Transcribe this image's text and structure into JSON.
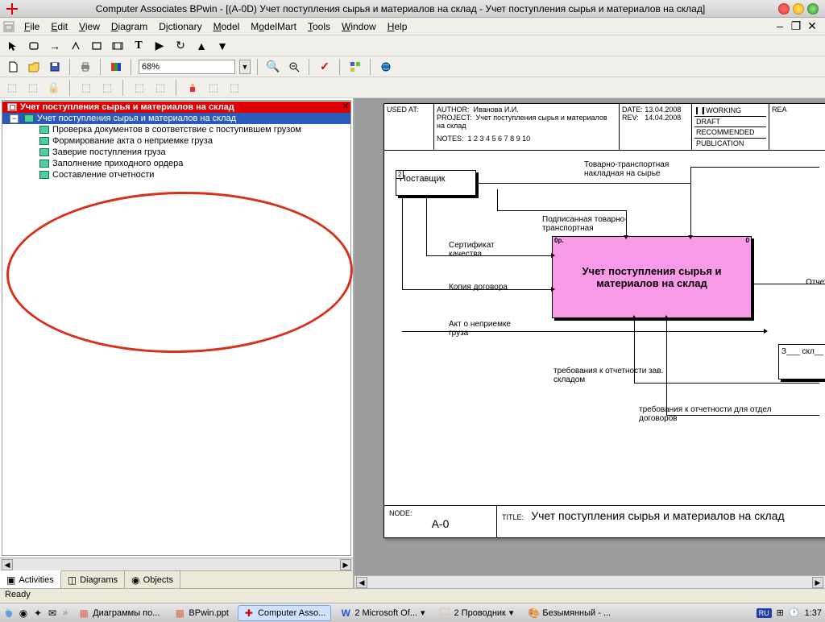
{
  "title": "Computer Associates BPwin - [(A-0D) Учет поступления сырья и материалов на склад - Учет поступления сырья и материалов на склад]",
  "menus": [
    "File",
    "Edit",
    "View",
    "Diagram",
    "Dictionary",
    "Model",
    "ModelMart",
    "Tools",
    "Window",
    "Help"
  ],
  "zoom": "68%",
  "tree": {
    "root": "Учет поступления сырья и материалов на склад",
    "selected": "Учет поступления сырья и материалов на склад",
    "children": [
      "Проверка документов  в соответствие  с поступившем грузом",
      "Формирование акта о неприемке груза",
      "Заверие  поступления груза",
      "Заполнение приходного ордера",
      "Составление  отчетности"
    ]
  },
  "tabs": {
    "activities": "Activities",
    "diagrams": "Diagrams",
    "objects": "Objects"
  },
  "header": {
    "used_at": "USED AT:",
    "author_lbl": "AUTHOR:",
    "author": "Иванова И.И.",
    "project_lbl": "PROJECT:",
    "project": "Учет поступления сырья и материалов на склад",
    "notes_lbl": "NOTES:",
    "notes": "1  2  3  4  5  6  7  8  9  10",
    "date_lbl": "DATE:",
    "date": "13.04.2008",
    "rev_lbl": "REV:",
    "rev": "14.04.2008",
    "working": "WORKING",
    "draft": "DRAFT",
    "recommended": "RECOMMENDED",
    "publication": "PUBLICATION",
    "rea": "REA"
  },
  "diagram": {
    "supplier": "Поставщик",
    "supplier_num": "2",
    "main_box": "Учет поступления сырья и материалов на склад",
    "main_num": "0р.",
    "main_num2": "0",
    "outbox": "З___\nскл__",
    "lbl_tovtrans": "Товарно-транспортная\nнакладная на сырье",
    "lbl_podpis": "Подписанная\nтоварно-транспортная",
    "lbl_cert": "Сертификат\nкачества",
    "lbl_kopiya": "Копия договора",
    "lbl_akt": "Акт о неприемке\nгруза",
    "lbl_otchet": "Отчетн",
    "lbl_treb1": "требования к отчетности\nзав. складом",
    "lbl_treb2": "требования к отчетности для отдел\nдоговоров",
    "node_lbl": "NODE:",
    "node": "A-0",
    "title_lbl": "TITLE:",
    "title": "Учет поступления сырья и материалов на склад"
  },
  "status": "Ready",
  "taskbar": {
    "items": [
      {
        "label": "Диаграммы по...",
        "icon": "ppt"
      },
      {
        "label": "BPwin.ppt",
        "icon": "ppt"
      },
      {
        "label": "Computer Asso...",
        "icon": "bpwin",
        "active": true
      },
      {
        "label": "2 Microsoft Of...",
        "icon": "word"
      },
      {
        "label": "2 Проводник",
        "icon": "folder"
      },
      {
        "label": "Безымянный - ...",
        "icon": "paint"
      }
    ],
    "lang": "RU",
    "time": "1:37"
  }
}
